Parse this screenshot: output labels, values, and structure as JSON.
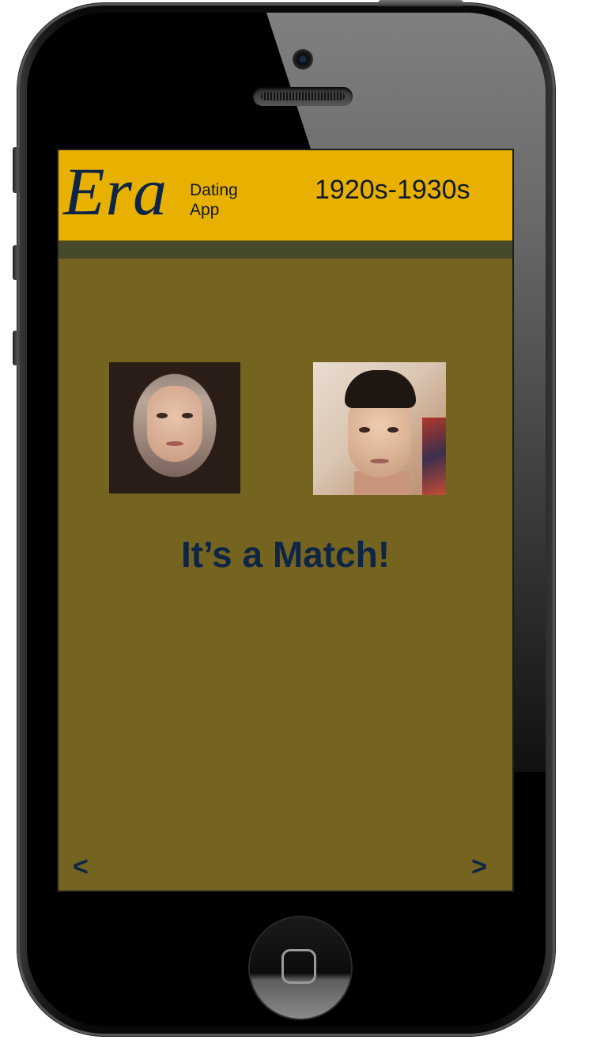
{
  "app": {
    "logo": "Era",
    "logo_subtitle_line1": "Dating",
    "logo_subtitle_line2": "App",
    "era_range": "1920s-1930s"
  },
  "match": {
    "message": "It’s a Match!"
  },
  "navigation": {
    "prev_label": "<",
    "next_label": ">"
  },
  "colors": {
    "header_bg": "#e8b000",
    "screen_bg": "#74641f",
    "subbar_bg": "#474a2a",
    "text_navy": "#0f2545"
  },
  "icons": {
    "home_button": "home-button-icon",
    "camera": "camera-icon",
    "speaker": "speaker-icon"
  }
}
